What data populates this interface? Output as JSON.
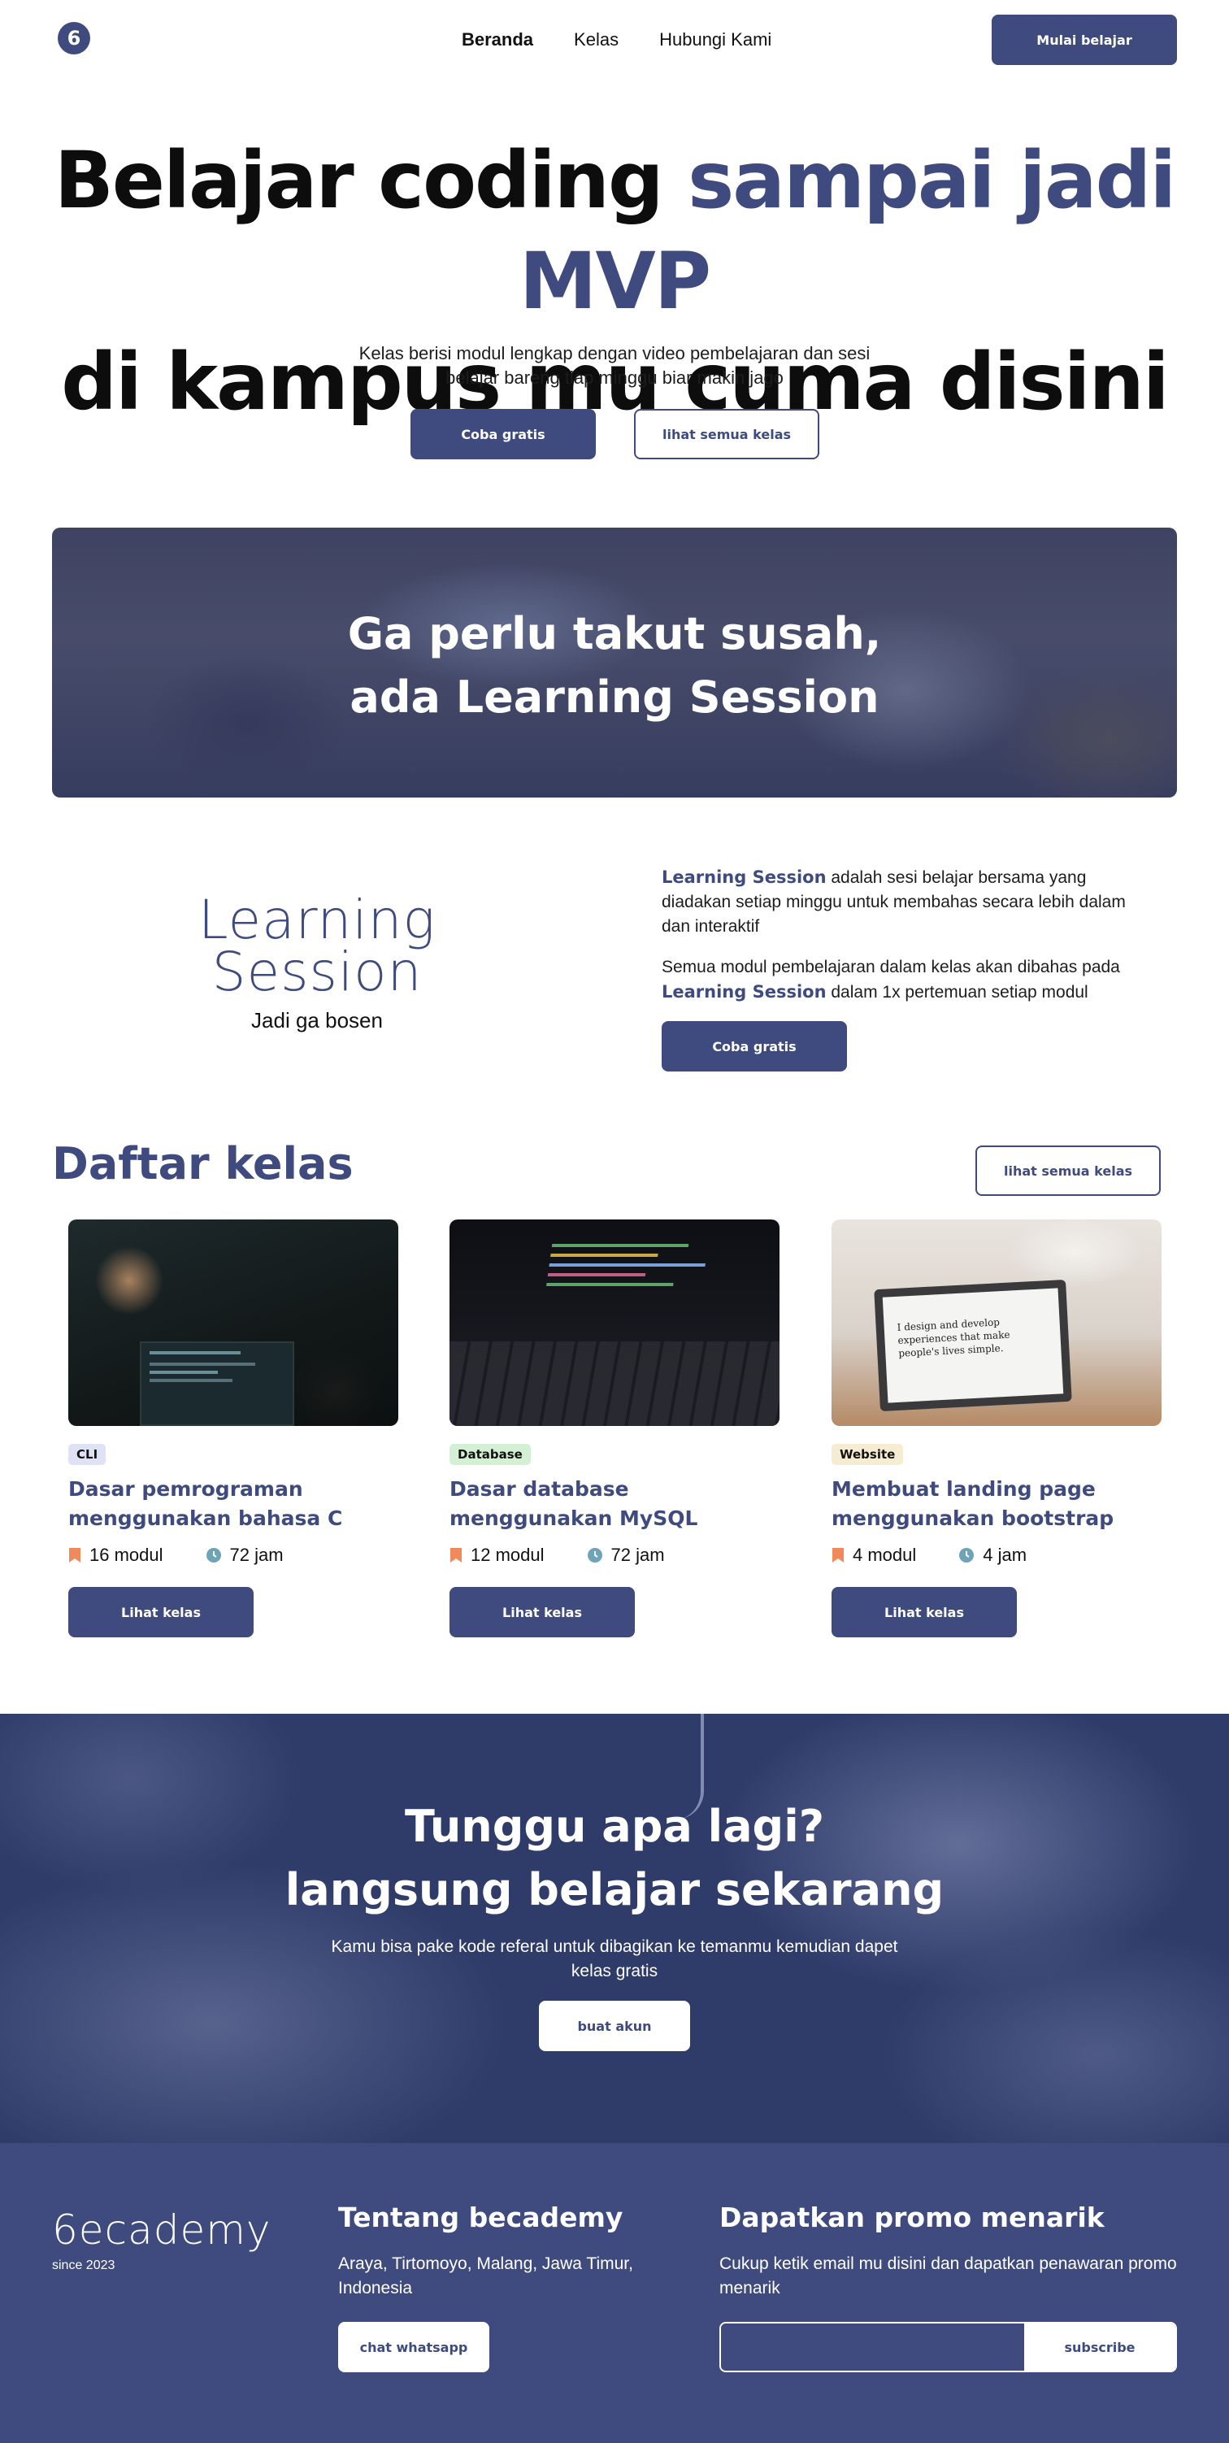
{
  "nav": {
    "logo_glyph": "6",
    "links": [
      "Beranda",
      "Kelas",
      "Hubungi Kami"
    ],
    "cta": "Mulai belajar"
  },
  "hero": {
    "title_part1": "Belajar coding ",
    "title_accent": "sampai jadi MVP",
    "title_line2": "di kampus mu cuma disini",
    "subtitle": "Kelas berisi modul lengkap dengan video pembelajaran dan sesi belajar bareng tiap minggu biar makin jago",
    "primary_button": "Coba gratis",
    "secondary_button": "lihat semua kelas"
  },
  "banner": {
    "line1": "Ga perlu takut susah,",
    "line2": "ada Learning Session"
  },
  "learning_session": {
    "logo_line1": "Learning",
    "logo_line2": "Session",
    "tagline": "Jadi ga bosen",
    "p1_bold": "Learning Session",
    "p1_rest": " adalah sesi belajar bersama yang diadakan setiap minggu untuk membahas secara lebih dalam dan interaktif",
    "p2_start": "Semua modul pembelajaran dalam kelas akan dibahas pada ",
    "p2_bold": "Learning Session",
    "p2_end": " dalam 1x pertemuan setiap modul",
    "button": "Coba gratis"
  },
  "courses": {
    "title": "Daftar kelas",
    "see_all": "lihat semua kelas",
    "items": [
      {
        "badge": "CLI",
        "badge_color": "#dfe2f5",
        "title": "Dasar pemrograman menggunakan bahasa C",
        "modules": "16 modul",
        "hours": "72 jam",
        "button": "Lihat kelas"
      },
      {
        "badge": "Database",
        "badge_color": "#d4f0d4",
        "title": "Dasar database menggunakan MySQL",
        "modules": "12 modul",
        "hours": "72 jam",
        "button": "Lihat kelas"
      },
      {
        "badge": "Website",
        "badge_color": "#f5ecd2",
        "title": "Membuat landing page menggunakan bootstrap",
        "modules": "4 modul",
        "hours": "4 jam",
        "button": "Lihat kelas"
      }
    ],
    "laptop_screen_text": [
      "I design and develop",
      "experiences that make",
      "people's lives simple."
    ]
  },
  "cta": {
    "line1": "Tunggu apa lagi?",
    "line2": "langsung belajar sekarang",
    "subtitle": "Kamu bisa pake kode referal untuk dibagikan ke temanmu kemudian dapet kelas gratis",
    "button": "buat akun"
  },
  "footer": {
    "brand": "6ecademy",
    "since": "since 2023",
    "about_title": "Tentang becademy",
    "address": "Araya, Tirtomoyo, Malang, Jawa Timur, Indonesia",
    "whatsapp_button": "chat whatsapp",
    "promo_title": "Dapatkan promo menarik",
    "promo_text": "Cukup ketik email mu disini dan dapatkan penawaran promo menarik",
    "email_value": "",
    "subscribe_button": "subscribe"
  },
  "colors": {
    "primary": "#3f4b7f",
    "cta_bg": "#2f3b69",
    "icon_module": "#f08a5d",
    "icon_clock": "#6fa3b8"
  }
}
